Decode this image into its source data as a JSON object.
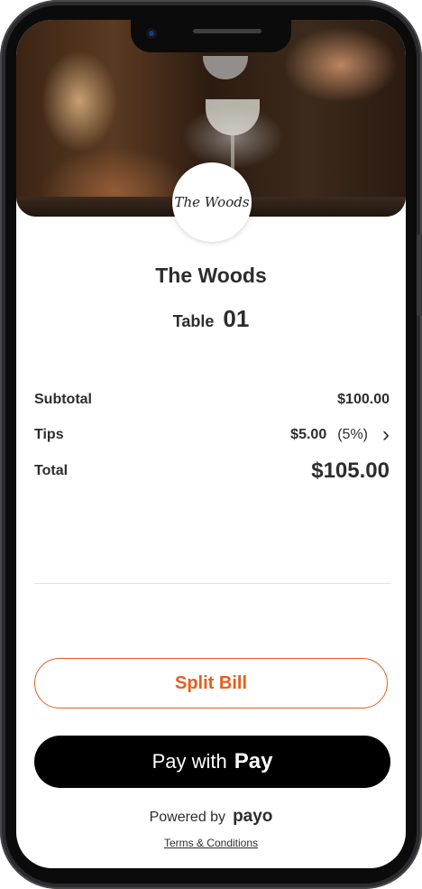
{
  "restaurant": {
    "logo_text": "The Woods",
    "name": "The Woods",
    "table_label": "Table",
    "table_number": "01"
  },
  "bill": {
    "subtotal_label": "Subtotal",
    "subtotal_value": "$100.00",
    "tips_label": "Tips",
    "tips_value": "$5.00",
    "tips_percent": "(5%)",
    "total_label": "Total",
    "total_value": "$105.00"
  },
  "actions": {
    "split_bill_label": "Split Bill",
    "pay_prefix": "Pay with",
    "pay_brand": "Pay"
  },
  "footer": {
    "powered_by": "Powered by",
    "brand": "payo",
    "terms": "Terms & Conditions"
  },
  "icons": {
    "chevron": "chevron-right-icon",
    "apple": "apple-icon"
  },
  "colors": {
    "accent": "#e85d1c",
    "pay_button": "#000000",
    "text": "#2d2d2d"
  }
}
